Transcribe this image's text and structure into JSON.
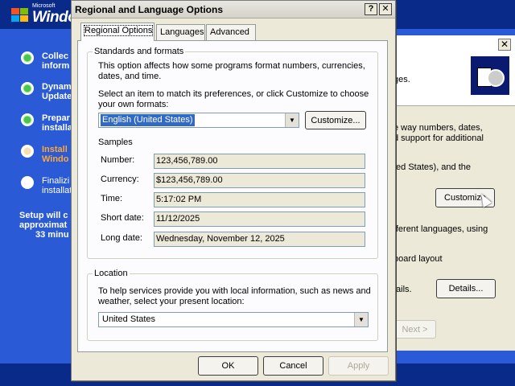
{
  "setup": {
    "logo": {
      "vendor": "Microsoft",
      "product": "Windo"
    },
    "steps": [
      {
        "lines": [
          "Collec",
          "inform"
        ],
        "state": "done"
      },
      {
        "lines": [
          "Dynam",
          "Update"
        ],
        "state": "done"
      },
      {
        "lines": [
          "Prepar",
          "installa"
        ],
        "state": "done"
      },
      {
        "lines": [
          "Install",
          "Windo"
        ],
        "state": "current"
      },
      {
        "lines": [
          "Finalizi",
          "installat"
        ],
        "state": "pending"
      }
    ],
    "eta_lines": [
      "Setup will c",
      "approximat",
      "33 minu"
    ]
  },
  "wizard": {
    "close_glyph": "✕",
    "texts": [
      "ges.",
      "e way numbers, dates,",
      "d support for additional",
      "ted States), and the",
      "fferent languages, using",
      "board layout",
      "tails."
    ],
    "customize_label": "Customize",
    "details_label": "Details...",
    "next_label": "Next >"
  },
  "dialog": {
    "title": "Regional and Language Options",
    "help_glyph": "?",
    "close_glyph": "✕",
    "tabs": [
      "Regional Options",
      "Languages",
      "Advanced"
    ],
    "standards": {
      "title": "Standards and formats",
      "desc1": [
        "This option affects how some programs format numbers, currencies,",
        "dates, and time."
      ],
      "desc2": [
        "Select an item to match its preferences, or click Customize to choose",
        "your own formats:"
      ],
      "format_value": "English (United States)",
      "customize_label": "Customize...",
      "samples_title": "Samples",
      "samples": [
        {
          "label": "Number:",
          "value": "123,456,789.00"
        },
        {
          "label": "Currency:",
          "value": "$123,456,789.00"
        },
        {
          "label": "Time:",
          "value": "5:17:02 PM"
        },
        {
          "label": "Short date:",
          "value": "11/12/2025"
        },
        {
          "label": "Long date:",
          "value": "Wednesday, November 12, 2025"
        }
      ]
    },
    "location": {
      "title": "Location",
      "desc": [
        "To help services provide you with local information, such as news and",
        "weather, select your present location:"
      ],
      "value": "United States"
    },
    "buttons": {
      "ok": "OK",
      "cancel": "Cancel",
      "apply": "Apply"
    }
  }
}
